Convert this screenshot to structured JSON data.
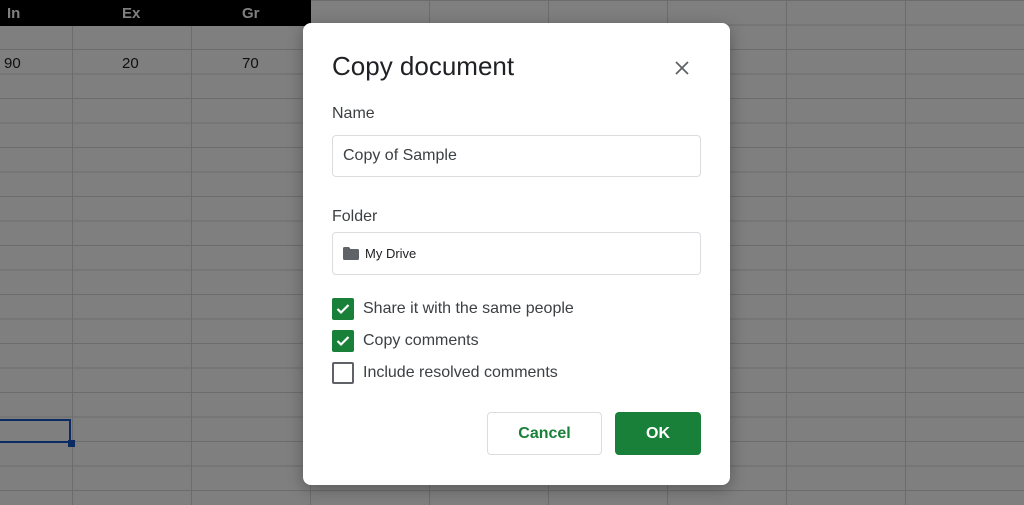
{
  "sheet": {
    "headers": [
      "In",
      "Ex",
      "Gr"
    ],
    "row": [
      "90",
      "20",
      "70"
    ]
  },
  "dialog": {
    "title": "Copy document",
    "name_label": "Name",
    "name_value": "Copy of Sample",
    "folder_label": "Folder",
    "folder_value": "My Drive",
    "options": [
      {
        "label": "Share it with the same people",
        "checked": true
      },
      {
        "label": "Copy comments",
        "checked": true
      },
      {
        "label": "Include resolved comments",
        "checked": false
      }
    ],
    "cancel_label": "Cancel",
    "ok_label": "OK"
  },
  "colors": {
    "accent": "#188038",
    "overlay": "rgba(0,0,0,0.5)",
    "selection": "#1a56c6"
  },
  "icons": [
    "close-icon",
    "folder-icon",
    "checkmark-icon"
  ]
}
